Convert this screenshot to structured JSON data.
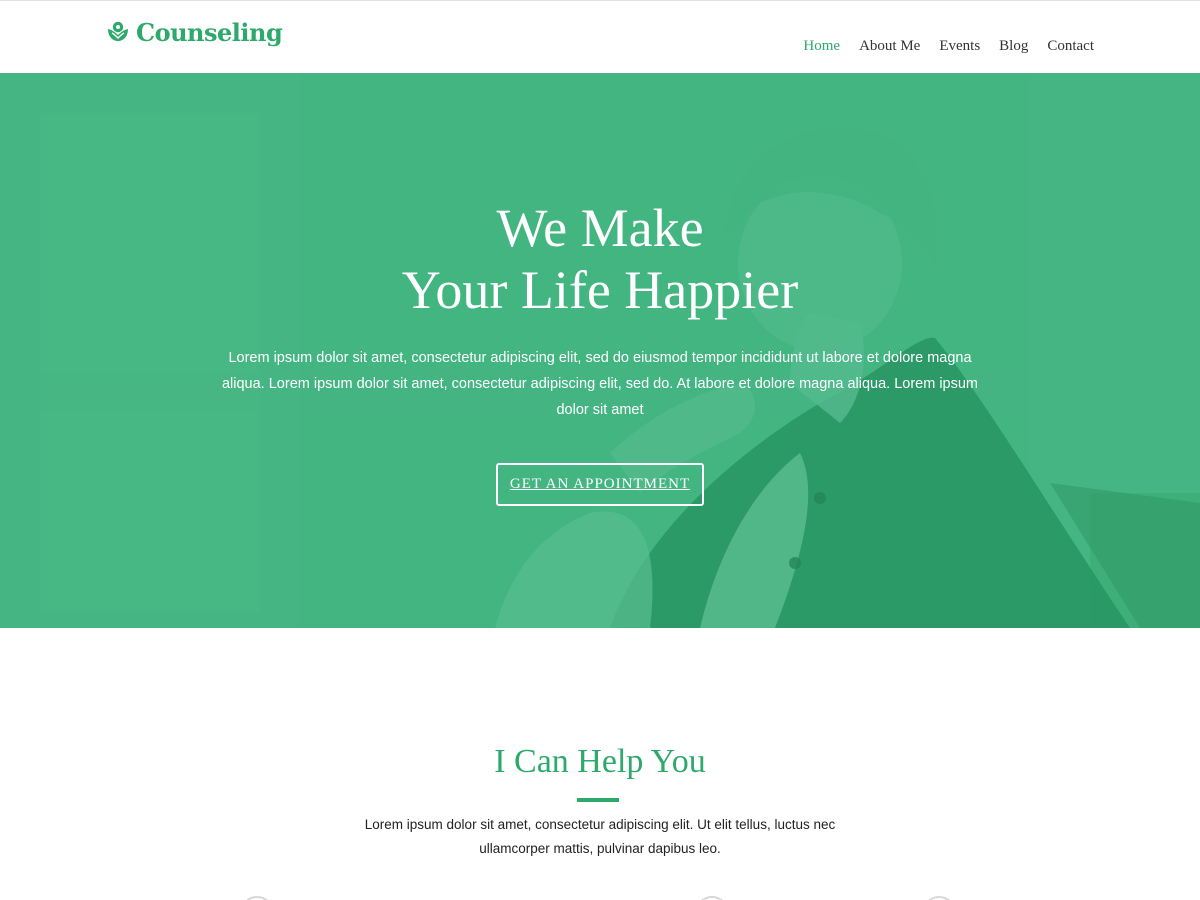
{
  "header": {
    "logo_text": "Counseling",
    "logo_icon": "flower-icon",
    "nav": [
      {
        "label": "Home",
        "active": true
      },
      {
        "label": "About Me",
        "active": false
      },
      {
        "label": "Events",
        "active": false
      },
      {
        "label": "Blog",
        "active": false
      },
      {
        "label": "Contact",
        "active": false
      }
    ]
  },
  "hero": {
    "title_line1": "We Make",
    "title_line2": "Your Life Happier",
    "text": "Lorem ipsum dolor sit amet, consectetur adipiscing elit, sed do eiusmod tempor incididunt ut labore et dolore magna aliqua. Lorem ipsum dolor sit amet, consectetur adipiscing elit, sed do. At labore et dolore magna aliqua. Lorem ipsum dolor sit amet",
    "button_label": "GET AN APPOINTMENT",
    "overlay_color": "#46b785"
  },
  "help": {
    "title": "I Can Help You",
    "text": "Lorem ipsum dolor sit amet, consectetur adipiscing elit. Ut elit tellus, luctus nec ullamcorper mattis, pulvinar dapibus leo."
  },
  "colors": {
    "brand_green": "#2ea96c",
    "hero_green": "#46b785"
  }
}
